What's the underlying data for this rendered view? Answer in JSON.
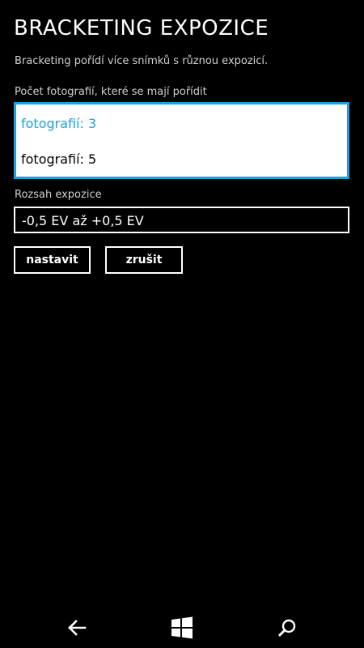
{
  "header": {
    "title": "BRACKETING EXPOZICE",
    "description": "Bracketing pořídí více snímků s různou expozicí."
  },
  "photo_count": {
    "label": "Počet fotografií, které se mají pořídit",
    "options": [
      {
        "label": "fotografií: 3",
        "selected": true
      },
      {
        "label": "fotografií: 5",
        "selected": false
      }
    ]
  },
  "exposure_range": {
    "label": "Rozsah expozice",
    "value": "-0,5 EV až +0,5 EV"
  },
  "actions": {
    "set_label": "nastavit",
    "cancel_label": "zrušit"
  },
  "navbar": {
    "back_icon": "back-arrow-icon",
    "start_icon": "windows-logo-icon",
    "search_icon": "search-icon"
  },
  "colors": {
    "accent": "#1ba1e2",
    "background": "#000000",
    "foreground": "#ffffff"
  }
}
